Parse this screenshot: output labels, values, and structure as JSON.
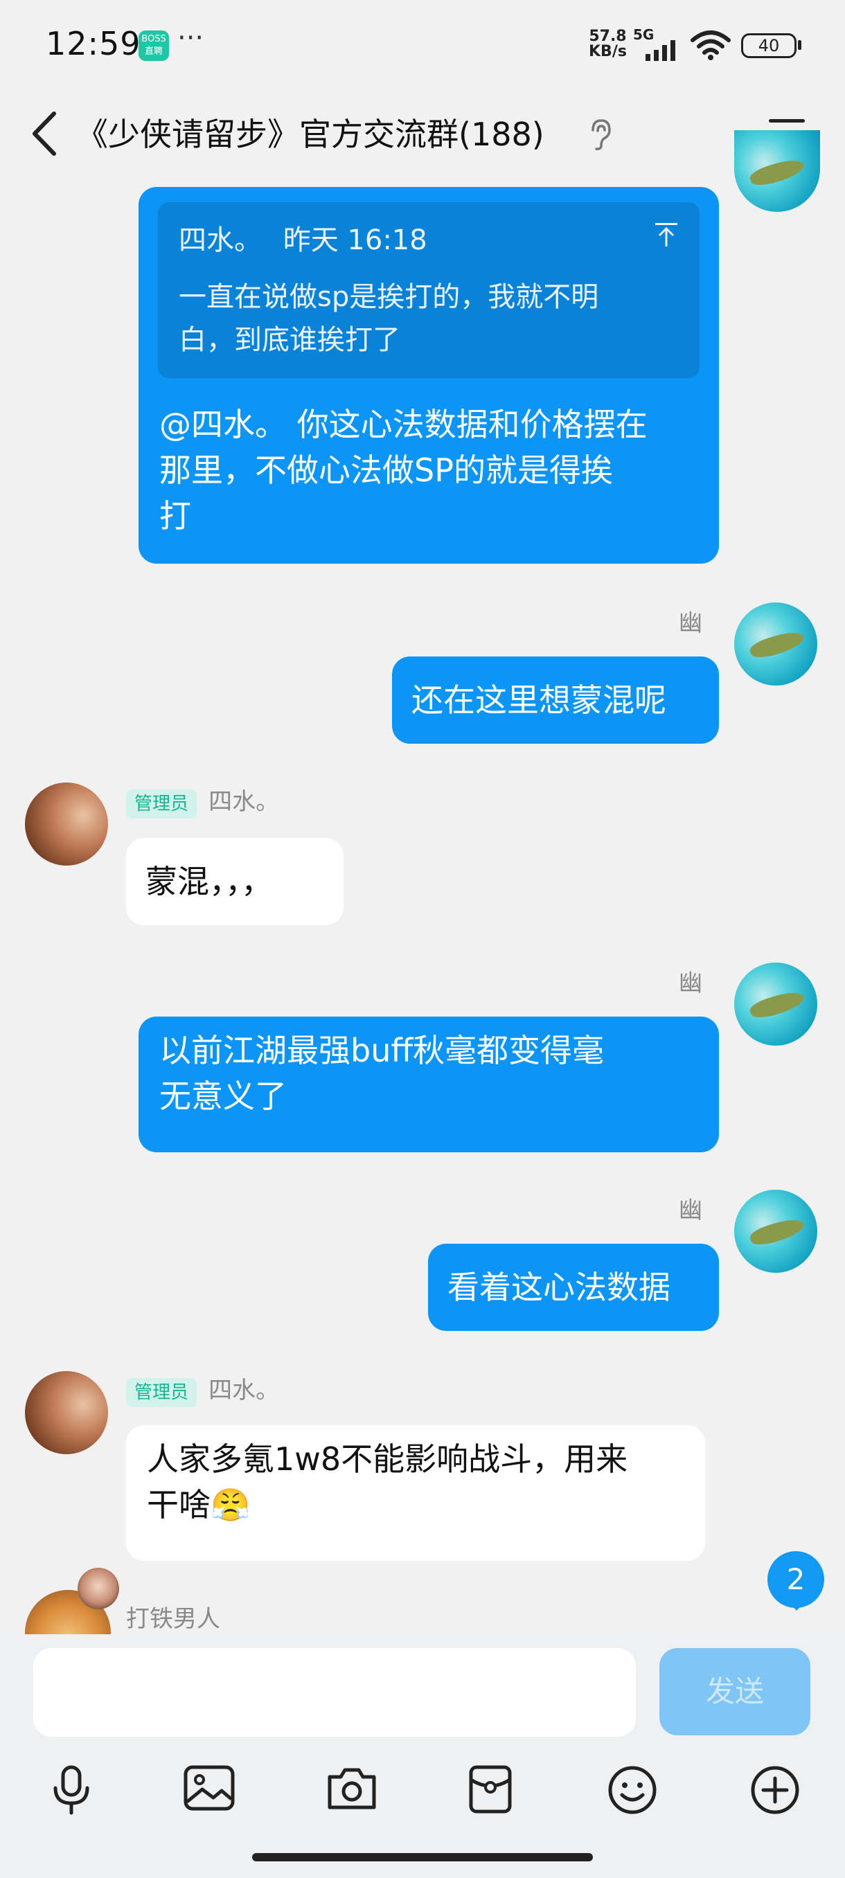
{
  "status_bar": {
    "time": "12:59",
    "boss_badge": "BOSS直聘",
    "more": "···",
    "net_speed_value": "57.8",
    "net_speed_unit": "KB/s",
    "network": "5G",
    "battery": "40"
  },
  "header": {
    "title": "《少侠请留步》官方交流群(188)"
  },
  "messages": [
    {
      "quote_author": "四水。",
      "quote_time": "昨天 16:18",
      "quote_line1": "一直在说做sp是挨打的，我就不明",
      "quote_line2": "白，到底谁挨打了",
      "line1": "@四水。 你这心法数据和价格摆在",
      "line2": "那里，不做心法做SP的就是得挨",
      "line3": "打"
    },
    {
      "sender": "幽",
      "text": "还在这里想蒙混呢"
    },
    {
      "sender": "四水。",
      "badge": "管理员",
      "text": "蒙混，，，"
    },
    {
      "sender": "幽",
      "line1": "以前江湖最强buff秋毫都变得毫",
      "line2": "无意义了"
    },
    {
      "sender": "幽",
      "text": "看着这心法数据"
    },
    {
      "sender": "四水。",
      "badge": "管理员",
      "line1": "人家多氪1w8不能影响战斗，用来",
      "line2": "干啥😤"
    },
    {
      "sender": "打铁男人"
    }
  ],
  "unread_count": "2",
  "composer": {
    "input_value": "",
    "send_label": "发送"
  },
  "toolbar": [
    "mic-icon",
    "image-icon",
    "camera-icon",
    "red-packet-icon",
    "emoji-icon",
    "plus-icon"
  ],
  "colors": {
    "outgoing_bubble": "#0d95f5",
    "quote_block": "#0a82d8",
    "admin_badge_text": "#19b291",
    "background": "#f1f1f1"
  }
}
